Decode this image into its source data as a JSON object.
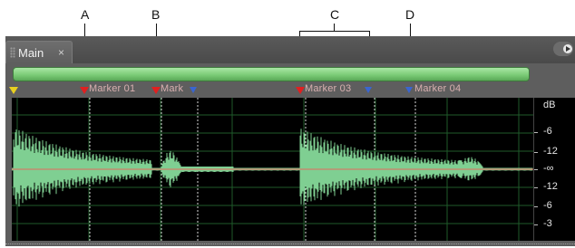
{
  "callouts": [
    "A",
    "B",
    "C",
    "D"
  ],
  "tab": {
    "label": "Main",
    "close": "×"
  },
  "markers": [
    {
      "label": "Marker 01",
      "kind": "point"
    },
    {
      "label": "Mark",
      "kind": "range"
    },
    {
      "label": "Marker 03",
      "kind": "range"
    },
    {
      "label": "Marker 04",
      "kind": "point"
    }
  ],
  "db_scale": {
    "unit": "dB",
    "labels": [
      "-6",
      "-12",
      "-∞",
      "-12",
      "-6",
      "-3"
    ]
  },
  "colors": {
    "waveform": "#7fcf92",
    "centerline": "#ff5050",
    "grid": "#1f5a2a",
    "marker_red": "#e02020",
    "marker_blue": "#3a66d0",
    "marker_yellow": "#e8d020",
    "overview_bar": "#78c974"
  },
  "icons": {
    "panel_menu": "panel-menu-icon",
    "tab_grip": "grip-icon",
    "close": "close-icon"
  }
}
